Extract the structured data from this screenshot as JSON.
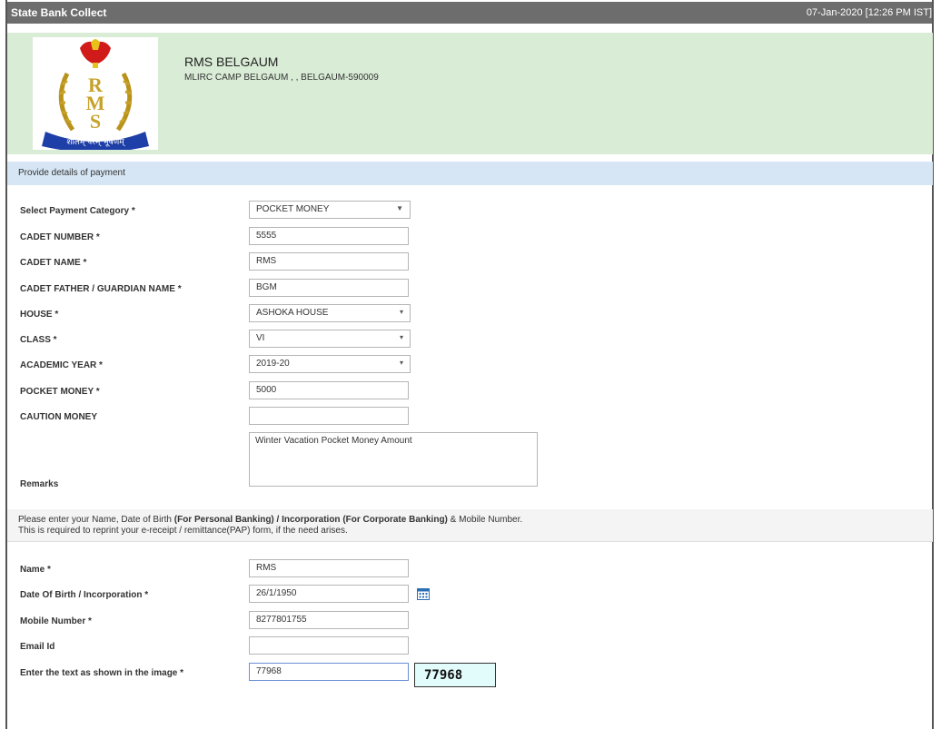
{
  "app": {
    "title": "State Bank Collect",
    "datetime": "07-Jan-2020 [12:26 PM IST]"
  },
  "org": {
    "name": "RMS BELGAUM",
    "address": "MLIRC CAMP BELGAUM , , BELGAUM-590009",
    "logo_icon": "rms-emblem",
    "logo_motto": "शीलम् परम् भूषणम्",
    "logo_letters": "RMS"
  },
  "section": {
    "title": "Provide details of payment"
  },
  "form": {
    "category": {
      "label": "Select Payment Category *",
      "value": "POCKET MONEY"
    },
    "cadet_number": {
      "label": "CADET NUMBER *",
      "value": "5555"
    },
    "cadet_name": {
      "label": "CADET NAME *",
      "value": "RMS"
    },
    "guardian": {
      "label": "CADET FATHER / GUARDIAN NAME *",
      "value": "BGM"
    },
    "house": {
      "label": "HOUSE *",
      "value": "ASHOKA HOUSE"
    },
    "class": {
      "label": "CLASS *",
      "value": "VI"
    },
    "year": {
      "label": "ACADEMIC YEAR *",
      "value": "2019-20"
    },
    "pocket_money": {
      "label": "POCKET MONEY *",
      "value": "5000"
    },
    "caution_money": {
      "label": "CAUTION MONEY",
      "value": ""
    },
    "remarks": {
      "label": "Remarks",
      "value": "Winter Vacation Pocket Money Amount"
    }
  },
  "note": {
    "line1_a": "Please enter your Name, Date of Birth ",
    "line1_b": "(For Personal Banking) / Incorporation (For Corporate Banking)",
    "line1_c": " & Mobile Number.",
    "line2": "This is required to reprint your e-receipt / remittance(PAP) form, if the need arises."
  },
  "personal": {
    "name": {
      "label": "Name *",
      "value": "RMS"
    },
    "dob": {
      "label": "Date Of Birth / Incorporation *",
      "value": "26/1/1950"
    },
    "mobile": {
      "label": "Mobile Number *",
      "value": "8277801755"
    },
    "email": {
      "label": "Email Id",
      "value": ""
    },
    "captcha_input": {
      "label": "Enter the text as shown in the image *",
      "value": "77968"
    },
    "captcha_image": "77968"
  },
  "icons": {
    "calendar": "calendar-icon",
    "dropdown": "chevron-down-icon"
  }
}
